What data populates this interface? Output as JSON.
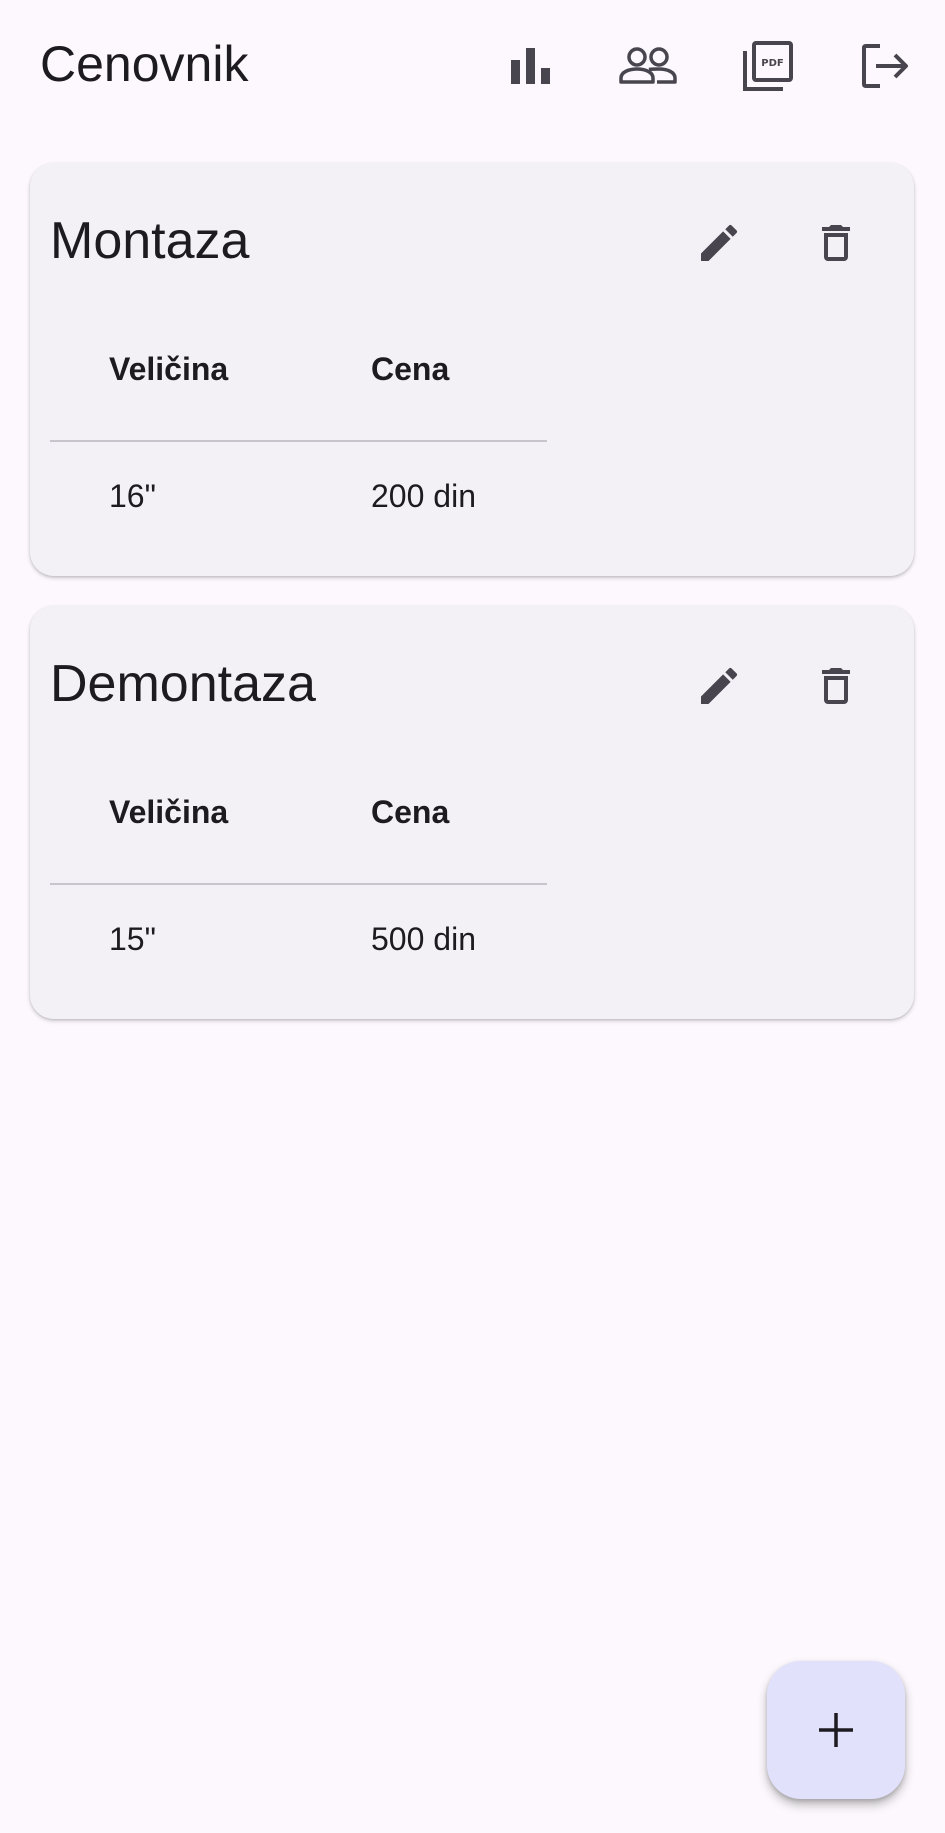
{
  "app_bar": {
    "title": "Cenovnik",
    "actions": [
      {
        "icon": "bar-chart-icon"
      },
      {
        "icon": "people-icon"
      },
      {
        "icon": "pdf-icon"
      },
      {
        "icon": "logout-icon"
      }
    ]
  },
  "cards": [
    {
      "title": "Montaza",
      "table": {
        "headers": [
          "Veličina",
          "Cena"
        ],
        "rows": [
          [
            "16\"",
            "200 din"
          ]
        ]
      }
    },
    {
      "title": "Demontaza",
      "table": {
        "headers": [
          "Veličina",
          "Cena"
        ],
        "rows": [
          [
            "15\"",
            "500 din"
          ]
        ]
      }
    }
  ],
  "fab": {
    "icon": "add-icon",
    "glyph": "+"
  },
  "colors": {
    "background": "#fcf8fd",
    "card": "#f3f1f6",
    "icon": "#49454f",
    "fab": "#e1e1fb",
    "text": "#1d1b20"
  }
}
